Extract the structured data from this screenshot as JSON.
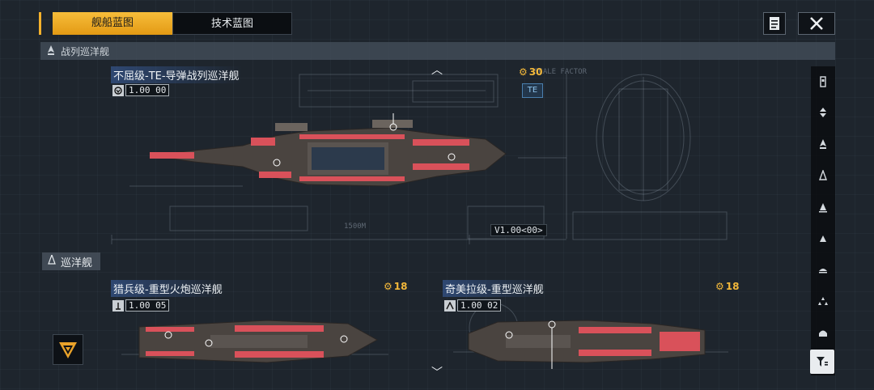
{
  "tabs": [
    {
      "label": "舰船蓝图",
      "active": true
    },
    {
      "label": "技术蓝图",
      "active": false
    }
  ],
  "top_buttons": {
    "notes_icon": "document-icon",
    "close_icon": "close-icon"
  },
  "section_battlecruiser": {
    "label": "战列巡洋舰"
  },
  "section_cruiser": {
    "label": "巡洋舰"
  },
  "ships": [
    {
      "name": "不屈级-TE-导弹战列巡洋舰",
      "version": "1.00",
      "version_suffix": "00",
      "cost": "30",
      "badge": "TE"
    },
    {
      "name": "猎兵级-重型火炮巡洋舰",
      "version": "1.00",
      "version_suffix": "05",
      "cost": "18"
    },
    {
      "name": "奇美拉级-重型巡洋舰",
      "version": "1.00",
      "version_suffix": "02",
      "cost": "18"
    }
  ],
  "blueprint_labels": {
    "scale": "1500M",
    "version_tag": "V1.00<00>"
  },
  "colors": {
    "accent": "#f4b12c",
    "ship_red": "#d9515a",
    "hull": "#4a4440"
  }
}
